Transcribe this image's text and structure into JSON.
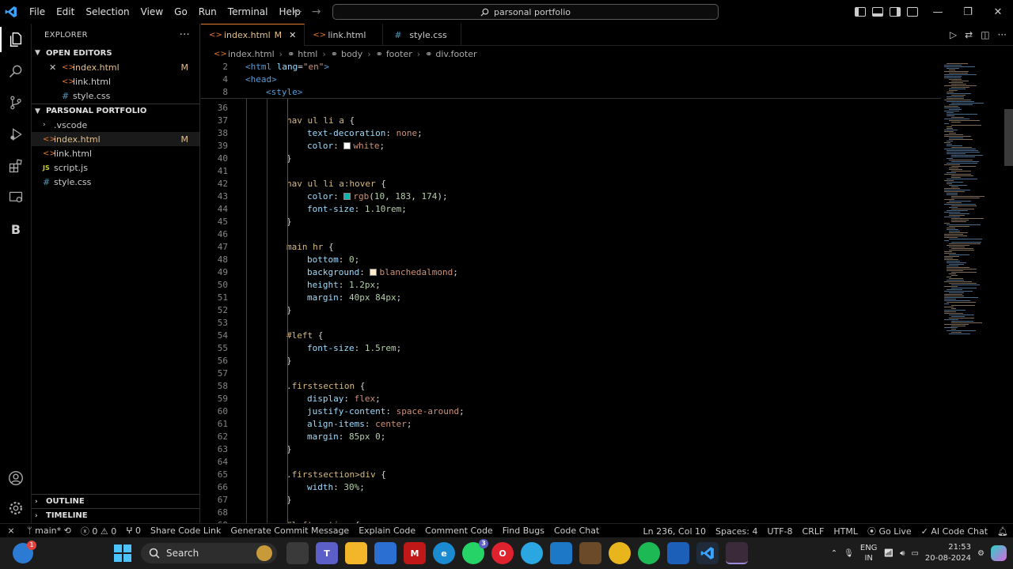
{
  "window": {
    "menu": [
      "File",
      "Edit",
      "Selection",
      "View",
      "Go",
      "Run",
      "Terminal",
      "Help"
    ],
    "command_center": "parsonal portfolio"
  },
  "explorer": {
    "title": "EXPLORER",
    "more": "···",
    "open_editors_label": "OPEN EDITORS",
    "open_editors": [
      {
        "name": "index.html",
        "badge": "M"
      },
      {
        "name": "link.html",
        "badge": ""
      },
      {
        "name": "style.css",
        "badge": ""
      }
    ],
    "project_label": "PARSONAL PORTFOLIO",
    "files": [
      {
        "name": ".vscode",
        "badge": ""
      },
      {
        "name": "index.html",
        "badge": "M"
      },
      {
        "name": "link.html",
        "badge": ""
      },
      {
        "name": "script.js",
        "badge": ""
      },
      {
        "name": "style.css",
        "badge": ""
      }
    ],
    "outline_label": "OUTLINE",
    "timeline_label": "TIMELINE"
  },
  "activity": {
    "accounts_letter": "B"
  },
  "tabs": [
    {
      "label": "index.html",
      "badge": "M",
      "close": "✕"
    },
    {
      "label": "link.html"
    },
    {
      "label": "style.css"
    }
  ],
  "breadcrumb": [
    "index.html",
    "html",
    "body",
    "footer",
    "div.footer"
  ],
  "sticky": [
    {
      "ln": "2",
      "html": "<span class='k-tag'>&lt;html</span> <span class='k-attr'>lang</span><span class='k-punc'>=</span><span class='k-str'>\"en\"</span><span class='k-tag'>&gt;</span>",
      "indent": 0
    },
    {
      "ln": "4",
      "html": "<span class='k-tag'>&lt;head&gt;</span>",
      "indent": 0
    },
    {
      "ln": "8",
      "html": "<span class='k-tag'>&lt;style&gt;</span>",
      "indent": 1
    }
  ],
  "lines": [
    {
      "ln": "36",
      "html": "",
      "indent": 2
    },
    {
      "ln": "37",
      "html": "<span class='k-sel'>nav ul li a</span> <span class='k-punc'>{</span>",
      "indent": 2
    },
    {
      "ln": "38",
      "html": "<span class='k-prop'>text-decoration</span><span class='k-punc'>: </span><span class='k-val'>none</span><span class='k-punc'>;</span>",
      "indent": 3
    },
    {
      "ln": "39",
      "html": "<span class='k-prop'>color</span><span class='k-punc'>: </span><span class='swatch' style='background:#ffffff'></span><span class='k-val'>white</span><span class='k-punc'>;</span>",
      "indent": 3
    },
    {
      "ln": "40",
      "html": "<span class='k-punc'>}</span>",
      "indent": 2
    },
    {
      "ln": "41",
      "html": "",
      "indent": 2
    },
    {
      "ln": "42",
      "html": "<span class='k-sel'>nav ul li a:hover</span> <span class='k-punc'>{</span>",
      "indent": 2
    },
    {
      "ln": "43",
      "html": "<span class='k-prop'>color</span><span class='k-punc'>: </span><span class='swatch' style='background:#0ab7ae'></span><span class='k-val'>rgb</span><span class='k-punc'>(</span><span class='k-num'>10</span><span class='k-punc'>, </span><span class='k-num'>183</span><span class='k-punc'>, </span><span class='k-num'>174</span><span class='k-punc'>);</span>",
      "indent": 3
    },
    {
      "ln": "44",
      "html": "<span class='k-prop'>font-size</span><span class='k-punc'>: </span><span class='k-num'>1.10rem</span><span class='k-punc'>;</span>",
      "indent": 3
    },
    {
      "ln": "45",
      "html": "<span class='k-punc'>}</span>",
      "indent": 2
    },
    {
      "ln": "46",
      "html": "",
      "indent": 2
    },
    {
      "ln": "47",
      "html": "<span class='k-sel'>main hr</span> <span class='k-punc'>{</span>",
      "indent": 2
    },
    {
      "ln": "48",
      "html": "<span class='k-prop'>bottom</span><span class='k-punc'>: </span><span class='k-num'>0</span><span class='k-punc'>;</span>",
      "indent": 3
    },
    {
      "ln": "49",
      "html": "<span class='k-prop'>background</span><span class='k-punc'>: </span><span class='swatch' style='background:#ffebcd'></span><span class='k-val'>blanchedalmond</span><span class='k-punc'>;</span>",
      "indent": 3
    },
    {
      "ln": "50",
      "html": "<span class='k-prop'>height</span><span class='k-punc'>: </span><span class='k-num'>1.2px</span><span class='k-punc'>;</span>",
      "indent": 3
    },
    {
      "ln": "51",
      "html": "<span class='k-prop'>margin</span><span class='k-punc'>: </span><span class='k-num'>40px</span> <span class='k-num'>84px</span><span class='k-punc'>;</span>",
      "indent": 3
    },
    {
      "ln": "52",
      "html": "<span class='k-punc'>}</span>",
      "indent": 2
    },
    {
      "ln": "53",
      "html": "",
      "indent": 2
    },
    {
      "ln": "54",
      "html": "<span class='k-sel'>#left</span> <span class='k-punc'>{</span>",
      "indent": 2
    },
    {
      "ln": "55",
      "html": "<span class='k-prop'>font-size</span><span class='k-punc'>: </span><span class='k-num'>1.5rem</span><span class='k-punc'>;</span>",
      "indent": 3
    },
    {
      "ln": "56",
      "html": "<span class='k-punc'>}</span>",
      "indent": 2
    },
    {
      "ln": "57",
      "html": "",
      "indent": 2
    },
    {
      "ln": "58",
      "html": "<span class='k-sel'>.firstsection</span> <span class='k-punc'>{</span>",
      "indent": 2
    },
    {
      "ln": "59",
      "html": "<span class='k-prop'>display</span><span class='k-punc'>: </span><span class='k-val'>flex</span><span class='k-punc'>;</span>",
      "indent": 3
    },
    {
      "ln": "60",
      "html": "<span class='k-prop'>justify-content</span><span class='k-punc'>: </span><span class='k-val'>space-around</span><span class='k-punc'>;</span>",
      "indent": 3
    },
    {
      "ln": "61",
      "html": "<span class='k-prop'>align-items</span><span class='k-punc'>: </span><span class='k-val'>center</span><span class='k-punc'>;</span>",
      "indent": 3
    },
    {
      "ln": "62",
      "html": "<span class='k-prop'>margin</span><span class='k-punc'>: </span><span class='k-num'>85px</span> <span class='k-num'>0</span><span class='k-punc'>;</span>",
      "indent": 3
    },
    {
      "ln": "63",
      "html": "<span class='k-punc'>}</span>",
      "indent": 2
    },
    {
      "ln": "64",
      "html": "",
      "indent": 2
    },
    {
      "ln": "65",
      "html": "<span class='k-sel'>.firstsection&gt;div</span> <span class='k-punc'>{</span>",
      "indent": 2
    },
    {
      "ln": "66",
      "html": "<span class='k-prop'>width</span><span class='k-punc'>: </span><span class='k-num'>30%</span><span class='k-punc'>;</span>",
      "indent": 3
    },
    {
      "ln": "67",
      "html": "<span class='k-punc'>}</span>",
      "indent": 2
    },
    {
      "ln": "68",
      "html": "",
      "indent": 2
    },
    {
      "ln": "69",
      "html": "<span class='k-sel'>#leftsection</span> <span class='k-punc'>{</span>",
      "indent": 2
    }
  ],
  "statusbar": {
    "branch": "main*",
    "errors": "0",
    "warnings": "0",
    "ports": "0",
    "left_items": [
      "Share Code Link",
      "Generate Commit Message",
      "Explain Code",
      "Comment Code",
      "Find Bugs",
      "Code Chat"
    ],
    "cursor": "Ln 236, Col 10",
    "spaces": "Spaces: 4",
    "encoding": "UTF-8",
    "eol": "CRLF",
    "language": "HTML",
    "golive": "Go Live",
    "aichat": "AI Code Chat"
  },
  "taskbar": {
    "search_label": "Search",
    "lang_top": "ENG",
    "lang_bottom": "IN",
    "time": "21:53",
    "date": "20-08-2024",
    "badge_count": "1",
    "whatsapp_badge": "3"
  }
}
